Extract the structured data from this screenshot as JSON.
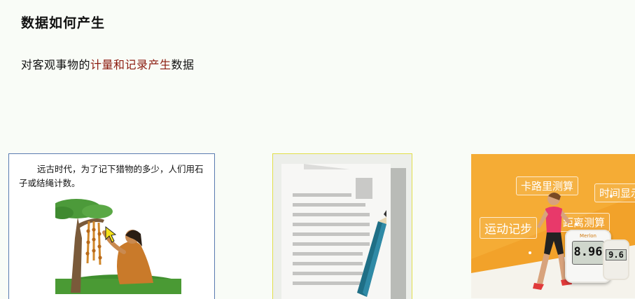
{
  "slide": {
    "title": "数据如何产生",
    "subtitle_prefix": "对客观事物的",
    "subtitle_highlight": "计量和记录产生",
    "subtitle_suffix": "数据",
    "highlight_color": "#8b1a0e"
  },
  "panels": {
    "ancient": {
      "caption": "远古时代，为了记下猎物的多少，人们用石子或结绳计数。"
    },
    "paper": {},
    "sports": {
      "tags": {
        "calorie": "卡路里测算",
        "time": "时间显示",
        "sport": "运动记步",
        "distance": "距离测算"
      },
      "device_brand": "Merlon",
      "device_reading": "8.96",
      "device_reading_2": "9.6"
    }
  }
}
